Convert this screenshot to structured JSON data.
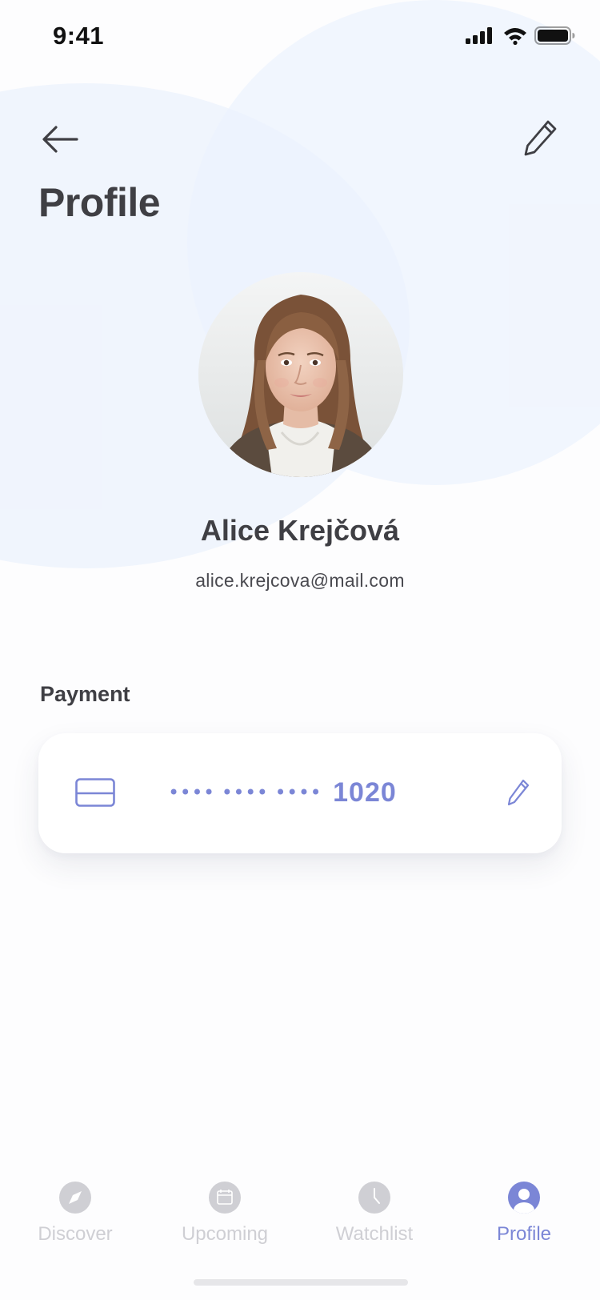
{
  "status_bar": {
    "time": "9:41"
  },
  "header": {
    "title": "Profile",
    "back_icon": "arrow-left-icon",
    "edit_icon": "pencil-icon"
  },
  "user": {
    "name": "Alice Krejčová",
    "email": "alice.krejcova@mail.com"
  },
  "payment": {
    "section_label": "Payment",
    "masked_number": "•••• •••• ••••",
    "last4": "1020",
    "card_icon": "credit-card-icon",
    "edit_icon": "pencil-icon"
  },
  "tabs": [
    {
      "label": "Discover",
      "icon": "compass-icon",
      "active": false
    },
    {
      "label": "Upcoming",
      "icon": "calendar-icon",
      "active": false
    },
    {
      "label": "Watchlist",
      "icon": "clock-icon",
      "active": false
    },
    {
      "label": "Profile",
      "icon": "user-icon",
      "active": true
    }
  ],
  "colors": {
    "accent": "#7b86d6",
    "text_primary": "#3f3f44",
    "tab_inactive": "#cfcfd4",
    "background_circle": "#ecf2fd"
  }
}
